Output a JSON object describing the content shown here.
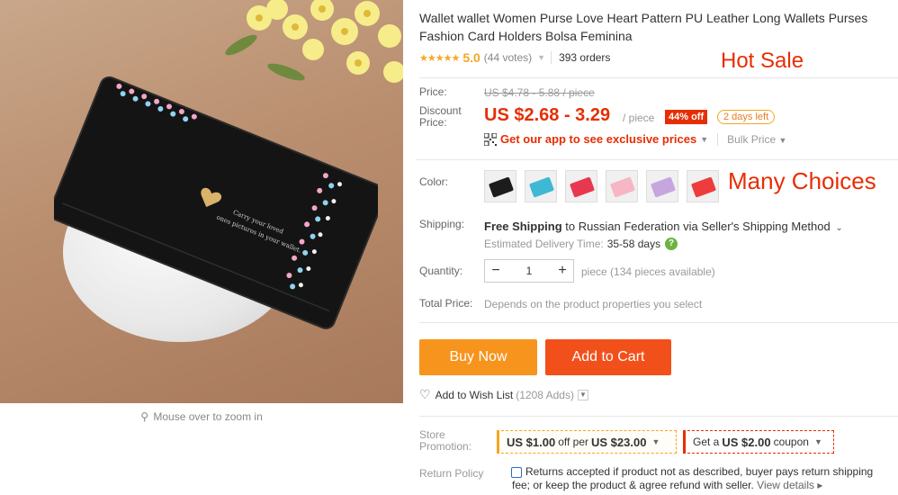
{
  "gallery": {
    "zoom_hint": "Mouse over to zoom in",
    "wallet_print_line1": "Carry your loved",
    "wallet_print_line2": "ones pictures in your wallet."
  },
  "product": {
    "title": "Wallet wallet Women Purse Love Heart Pattern PU Leather Long Wallets Purses Fashion Card Holders Bolsa Feminina",
    "stars": "★★★★★",
    "score": "5.0",
    "votes": "(44 votes)",
    "orders": "393 orders",
    "hot_sale": "Hot Sale"
  },
  "price": {
    "label": "Price:",
    "original": "US $4.78 - 5.88 / piece",
    "discount_label_1": "Discount",
    "discount_label_2": "Price:",
    "discount": "US $2.68 - 3.29",
    "per_piece": "/ piece",
    "off_badge": "44% off",
    "days_left": "2 days left",
    "app_offer": "Get our app to see exclusive prices",
    "bulk_price": "Bulk Price"
  },
  "color": {
    "label": "Color:",
    "many_choices": "Many Choices",
    "swatch_colors": [
      "#1c1c1c",
      "#3fb8d4",
      "#e8384f",
      "#f7b6c4",
      "#c7a6e0",
      "#ee3b3b"
    ]
  },
  "shipping": {
    "label": "Shipping:",
    "free": "Free Shipping",
    "to": "to",
    "destination": "Russian Federation via Seller's Shipping Method",
    "estimated_label": "Estimated Delivery Time:",
    "estimated_value": "35-58 days"
  },
  "quantity": {
    "label": "Quantity:",
    "minus": "−",
    "value": "1",
    "plus": "+",
    "note": "piece (134 pieces available)"
  },
  "total": {
    "label": "Total Price:",
    "note": "Depends on the product properties you select"
  },
  "actions": {
    "buy_now": "Buy Now",
    "add_to_cart": "Add to Cart",
    "wish_label": "Add to Wish List",
    "wish_count": "(1208 Adds)"
  },
  "promotion": {
    "label_1": "Store",
    "label_2": "Promotion:",
    "coupon1_amount": "US $1.00",
    "coupon1_mid": "off per",
    "coupon1_threshold": "US $23.00",
    "coupon2_prefix": "Get a",
    "coupon2_amount": "US $2.00",
    "coupon2_suffix": "coupon"
  },
  "returns": {
    "label": "Return Policy",
    "text": "Returns accepted if product not as described, buyer pays return shipping fee; or keep the product & agree refund with seller.",
    "details": "View details ▸"
  }
}
